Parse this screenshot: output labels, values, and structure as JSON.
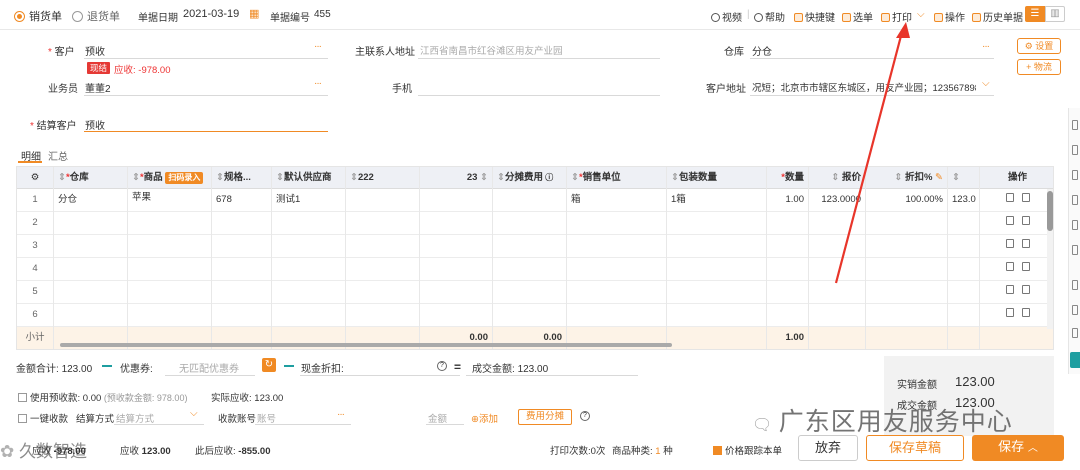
{
  "topbar": {
    "tab_sales": "销货单",
    "tab_return": "退货单",
    "date_label": "单据日期",
    "date_value": "2021-03-19",
    "no_label": "单据编号",
    "no_value": "455",
    "video": "视频",
    "help": "帮助",
    "shortcut": "快捷键",
    "select": "选单",
    "print": "打印",
    "ops": "操作",
    "history": "历史单据"
  },
  "form": {
    "customer_label": "客户",
    "customer_value": "预收",
    "cash_tag": "现结",
    "receivable": "应收: -978.00",
    "contact_label": "主联系人地址",
    "contact_value": "江西省南昌市红谷滩区用友产业园",
    "warehouse_label": "仓库",
    "warehouse_value": "分仓",
    "salesman_label": "业务员",
    "salesman_value": "董董2",
    "phone_label": "手机",
    "cust_addr_label": "客户地址",
    "cust_addr_value": "况短；北京市市辖区东城区，用友产业园；123567898…",
    "settle_label": "结算客户",
    "settle_value": "预收",
    "settings_btn": "设置",
    "logistics_btn": "物流"
  },
  "tabs": {
    "detail": "明细",
    "summary": "汇总"
  },
  "grid": {
    "headers": [
      "仓库",
      "商品",
      "规格...",
      "默认供应商",
      "222",
      "23",
      "分摊费用",
      "销售单位",
      "包装数量",
      "数量",
      "报价",
      "折扣%",
      "",
      "操作"
    ],
    "scan_tag": "扫码录入",
    "rows": [
      {
        "no": "1",
        "wh": "分仓",
        "goods": "苹果",
        "spec": "678",
        "supplier": "测试1",
        "unit": "箱",
        "pack": "1箱",
        "qty": "1.00",
        "price": "123.0000",
        "disc": "100.00%",
        "extra": "123.0"
      },
      {
        "no": "2"
      },
      {
        "no": "3"
      },
      {
        "no": "4"
      },
      {
        "no": "5"
      },
      {
        "no": "6"
      }
    ],
    "subtotal_label": "小计",
    "subtotal_23": "0.00",
    "subtotal_fee": "0.00",
    "subtotal_qty": "1.00"
  },
  "summary": {
    "total_label": "金额合计:",
    "total_value": "123.00",
    "coupon_label": "优惠券:",
    "coupon_value": "无匹配优惠券",
    "cash_disc_label": "现金折扣:",
    "deal_label": "成交金额:",
    "deal_value": "123.00",
    "use_prepay": "使用预收款:",
    "prepay_value": "0.00",
    "prepay_balance": "(预收款金额: 978.00)",
    "actual_label": "实际应收:",
    "actual_value": "123.00",
    "one_key": "一键收款",
    "settle_method_label": "结算方式",
    "settle_method_ph": "结算方式",
    "account_label": "收款账号",
    "account_ph": "账号",
    "amount_ph": "金额",
    "add": "添加",
    "fee_split": "费用分摊",
    "right_sales_label": "实销金额",
    "right_sales_value": "123.00",
    "right_deal_label": "成交金额",
    "right_deal_value": "123.00"
  },
  "bottombar": {
    "receivable_label": "应收",
    "receivable_value": "-978.00",
    "due_label": "应收",
    "due_value": "123.00",
    "after_label": "此后应收:",
    "after_value": "-855.00",
    "print_count": "打印次数:0次",
    "kinds_label": "商品种类:",
    "kinds_value": "1",
    "kinds_unit": "种",
    "price_follow": "价格跟踪本单",
    "abandon": "放弃",
    "save_draft": "保存草稿",
    "save": "保存"
  },
  "watermark": {
    "text": "广东区用友服务中心",
    "text2": "久数智造"
  },
  "colors": {
    "accent": "#f08a24",
    "danger": "#e33",
    "arrow": "#e8352a"
  }
}
